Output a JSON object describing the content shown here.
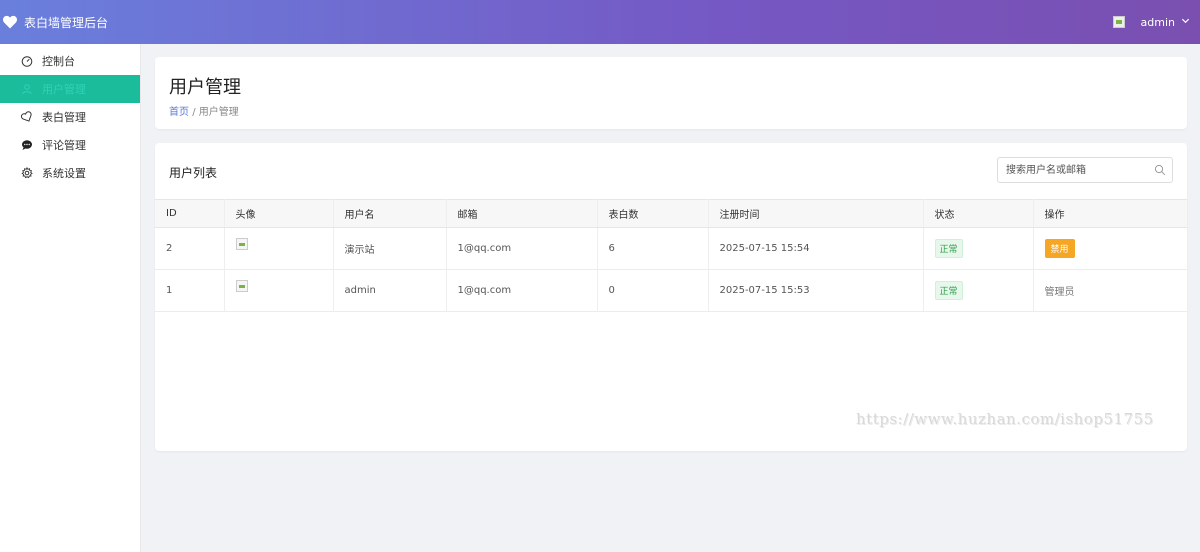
{
  "app": {
    "title": "表白墙管理后台"
  },
  "header": {
    "username": "admin"
  },
  "sidebar": {
    "items": [
      {
        "label": "控制台",
        "icon": "dashboard-icon",
        "active": false
      },
      {
        "label": "用户管理",
        "icon": "user-icon",
        "active": true
      },
      {
        "label": "表白管理",
        "icon": "heart-outline-icon",
        "active": false
      },
      {
        "label": "评论管理",
        "icon": "comment-icon",
        "active": false
      },
      {
        "label": "系统设置",
        "icon": "gear-icon",
        "active": false
      }
    ]
  },
  "page": {
    "title": "用户管理",
    "breadcrumb": {
      "home": "首页",
      "separator": "/",
      "current": "用户管理"
    }
  },
  "list": {
    "title": "用户列表",
    "search_placeholder": "搜索用户名或邮箱",
    "columns": [
      "ID",
      "头像",
      "用户名",
      "邮箱",
      "表白数",
      "注册时间",
      "状态",
      "操作"
    ],
    "rows": [
      {
        "id": "2",
        "username": "演示站",
        "email": "1@qq.com",
        "posts": "6",
        "registered": "2025-07-15 15:54",
        "status": "正常",
        "action": "禁用",
        "action_type": "button"
      },
      {
        "id": "1",
        "username": "admin",
        "email": "1@qq.com",
        "posts": "0",
        "registered": "2025-07-15 15:53",
        "status": "正常",
        "action": "管理员",
        "action_type": "text"
      }
    ]
  },
  "watermark": "https://www.huzhan.com/ishop51755",
  "colors": {
    "accent": "#1abc9c",
    "header_start": "#6a7fdc",
    "header_end": "#7a4fb0",
    "warning": "#f5a623",
    "success": "#2e9e4a"
  }
}
